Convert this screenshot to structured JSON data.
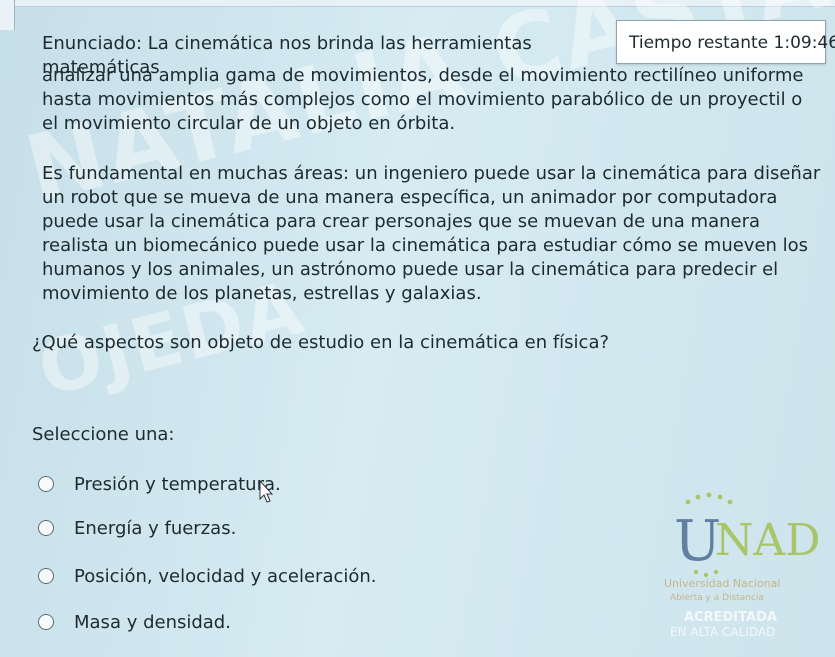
{
  "timer": {
    "label": "Tiempo restante",
    "value": "1:09:46"
  },
  "statement": {
    "line1": "Enunciado: La cinemática nos brinda las herramientas matemáticas",
    "line1_rest": "analizar una amplia gama de movimientos, desde el movimiento rectilíneo uniforme hasta movimientos más complejos como el movimiento parabólico de un proyectil o el movimiento circular de un objeto en órbita.",
    "paragraph2": "Es fundamental en muchas áreas: un ingeniero puede usar la cinemática para diseñar un robot que se mueva de una manera específica, un animador por computadora puede usar la cinemática para crear personajes que se muevan de una manera realista un biomecánico puede usar la cinemática para estudiar cómo se mueven los humanos y los animales, un astrónomo puede usar la cinemática para predecir el movimiento de los planetas, estrellas y galaxias."
  },
  "question": "¿Qué aspectos son objeto de estudio en la cinemática en física?",
  "select_label": "Seleccione una:",
  "options": [
    "Presión y temperatura.",
    "Energía y fuerzas.",
    "Posición, velocidad y aceleración.",
    "Masa y densidad."
  ],
  "watermark": {
    "line1": "NATALIA CASTANEDA",
    "line2": "OJEDA"
  },
  "logo": {
    "name": "UNAD",
    "subtitle": "Universidad Nacional",
    "subtitle2": "Abierta y a Distancia",
    "accredited": "ACREDITADA",
    "quality": "EN ALTA CALIDAD"
  },
  "colors": {
    "background": "#cfe6ee",
    "text": "#1d2a30",
    "logo_green": "#9dbb3c",
    "logo_blue": "#3b5f87"
  }
}
